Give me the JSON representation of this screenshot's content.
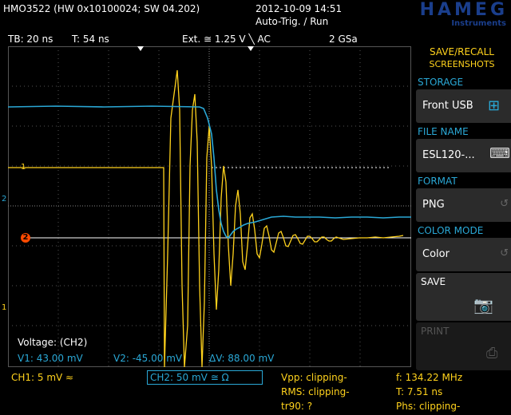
{
  "top": {
    "model": "HMO3522 (HW 0x10100024; SW 04.202)",
    "datetime": "2012-10-09 14:51",
    "mode": "Auto-Trig. / Run",
    "brand": "HAMEG",
    "brand_sub": "Instruments"
  },
  "status": {
    "timebase": "TB: 20 ns",
    "trigger_time": "T: 54 ns",
    "trigger_setting": "Ext. ≅ 1.25 V ╲ AC",
    "sample_rate": "2 GSa"
  },
  "menu": {
    "title_line1": "SAVE/RECALL",
    "title_line2": "SCREENSHOTS",
    "storage_label": "STORAGE",
    "storage_value": "Front USB",
    "filename_label": "FILE NAME",
    "filename_value": "ESL120-...",
    "format_label": "FORMAT",
    "format_value": "PNG",
    "colormode_label": "COLOR MODE",
    "colormode_value": "Color",
    "save_label": "SAVE",
    "print_label": "PRINT",
    "cycle_glyph": "↺"
  },
  "overlay": {
    "voltage_label": "Voltage: (CH2)",
    "v1": "V1: 43.00 mV",
    "v2": "V2: -45.00 mV",
    "dv": "ΔV: 88.00 mV"
  },
  "markers": {
    "ch1": "1",
    "ch2": "2",
    "ch2_ref": "2",
    "ext": "1"
  },
  "bottom": {
    "ch1": "CH1: 5 mV ≈",
    "ch2": "CH2: 50 mV ≅ Ω",
    "vpp": "Vpp: clipping-",
    "rms": "RMS: clipping-",
    "tr90": "tr90: ?",
    "freq": "f: 134.22 MHz",
    "period": "T: 7.51 ns",
    "phase": "Phs: clipping-"
  },
  "colors": {
    "ch1": "#ffd21c",
    "ch2": "#2aa8d6",
    "ref": "#ff4a00",
    "brand": "#1a3e8c"
  }
}
